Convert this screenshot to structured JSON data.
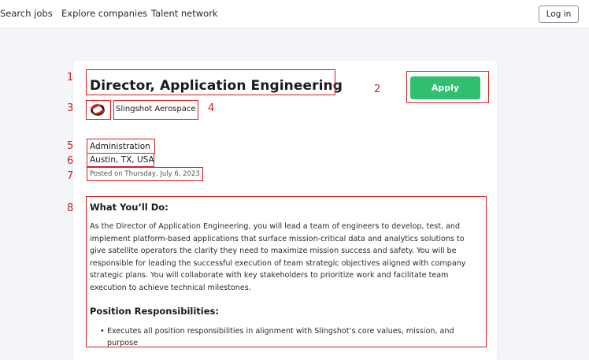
{
  "nav": {
    "search_jobs": "Search jobs",
    "explore_companies": "Explore companies",
    "talent_network": "Talent network",
    "login": "Log in"
  },
  "job": {
    "title": "Director, Application Engineering",
    "apply_label": "Apply",
    "company": "Slingshot Aerospace",
    "company_logo_icon": "slingshot-logo-icon",
    "department": "Administration",
    "location": "Austin, TX, USA",
    "posted": "Posted on Thursday, July 6, 2023"
  },
  "description": {
    "heading1": "What You’ll Do:",
    "body": "As the Director of Application Engineering, you will lead a team of engineers to develop, test, and implement platform-based applications that surface mission-critical data and analytics solutions to give satellite operators the clarity they need to maximize mission success and safety. You will be responsible for leading the successful execution of team strategic objectives aligned with company strategic plans. You will collaborate with key stakeholders to prioritize work and facilitate team execution to achieve technical milestones.",
    "heading2": "Position Responsibilities:",
    "bullets": [
      "Executes all position responsibilities in alignment with Slingshot’s core values, mission, and purpose"
    ]
  },
  "annotations": [
    "1",
    "2",
    "3",
    "4",
    "5",
    "6",
    "7",
    "8"
  ],
  "colors": {
    "apply": "#2fbf71",
    "annotation": "#d31f1f"
  }
}
